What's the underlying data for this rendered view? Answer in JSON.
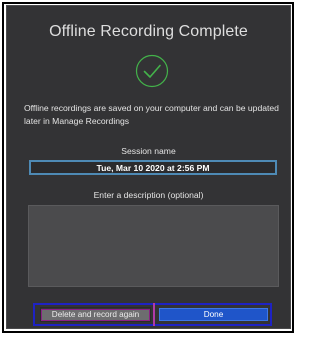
{
  "dialog": {
    "title": "Offline Recording Complete",
    "success_icon": "checkmark-circle-icon",
    "info_text": "Offline recordings are saved on your computer and can be updated later in Manage Recordings",
    "session_name_label": "Session name",
    "session_name_value": "Tue, Mar 10 2020 at 2:56 PM",
    "description_label": "Enter a description (optional)",
    "description_value": "",
    "buttons": {
      "delete_label": "Delete and record again",
      "done_label": "Done"
    }
  },
  "colors": {
    "dialog_background": "#333335",
    "check_green": "#43b24a",
    "primary_button": "#1f55c9",
    "input_focus_border": "#4e8ab5",
    "highlight_border": "#1e22c4",
    "divider_magenta": "#b03aa8"
  }
}
